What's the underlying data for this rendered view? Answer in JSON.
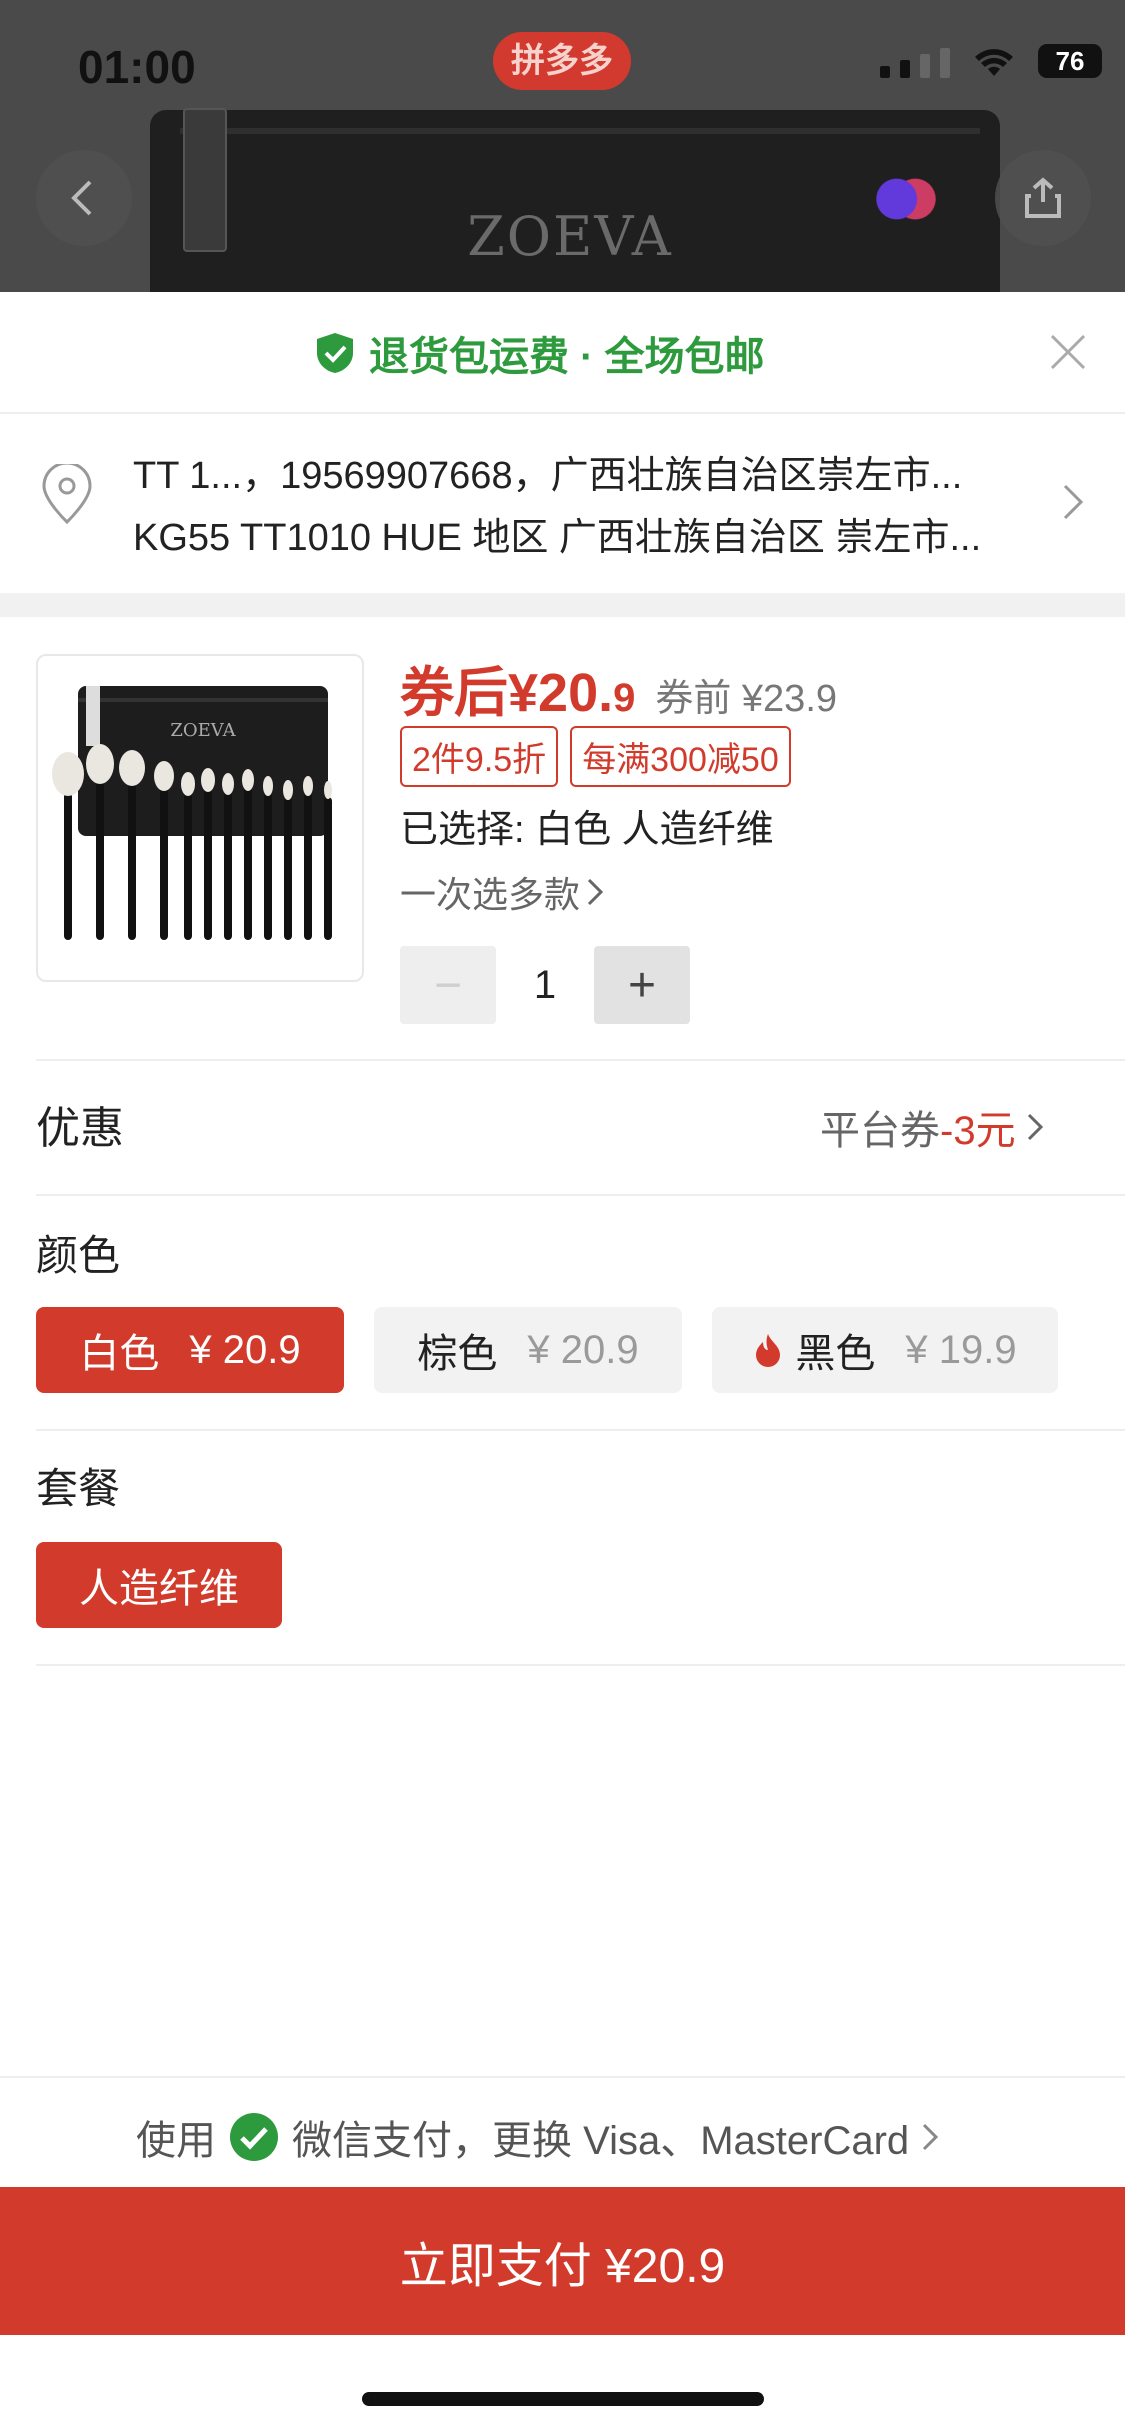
{
  "status_bar": {
    "time": "01:00",
    "app_badge": "拼多多",
    "battery": "76"
  },
  "hero": {
    "brand": "ZOEVA"
  },
  "sheet": {
    "banner": {
      "text": "退货包运费 · 全场包邮"
    },
    "address": {
      "line1": "TT 1...，19569907668，广西壮族自治区崇左市...",
      "line2": "KG55 TT1010 HUE 地区 广西壮族自治区 崇左市..."
    },
    "product": {
      "price_after_label": "券后",
      "price_after_main": "¥20.",
      "price_after_decimal": "9",
      "price_before": "券前 ¥23.9",
      "tags": [
        "2件9.5折",
        "每满300减50"
      ],
      "selected": "已选择: 白色 人造纤维",
      "multi_select": "一次选多款",
      "quantity": "1",
      "minus": "−",
      "plus": "+"
    },
    "discount": {
      "label": "优惠",
      "value_prefix": "平台券",
      "value_amount": "-3元"
    },
    "colors": {
      "title": "颜色",
      "options": [
        {
          "name": "白色",
          "price": "¥ 20.9",
          "selected": true
        },
        {
          "name": "棕色",
          "price": "¥ 20.9",
          "selected": false
        },
        {
          "name": "黑色",
          "price": "¥ 19.9",
          "selected": false,
          "hot": true
        }
      ]
    },
    "package": {
      "title": "套餐",
      "options": [
        {
          "name": "人造纤维",
          "selected": true
        }
      ]
    },
    "payment": {
      "prefix": "使用",
      "method": "微信支付，更换 Visa、MasterCard",
      "button": "立即支付 ¥20.9"
    }
  },
  "colors_theme": {
    "accent": "#d23b2c",
    "green": "#2e9a3e"
  }
}
